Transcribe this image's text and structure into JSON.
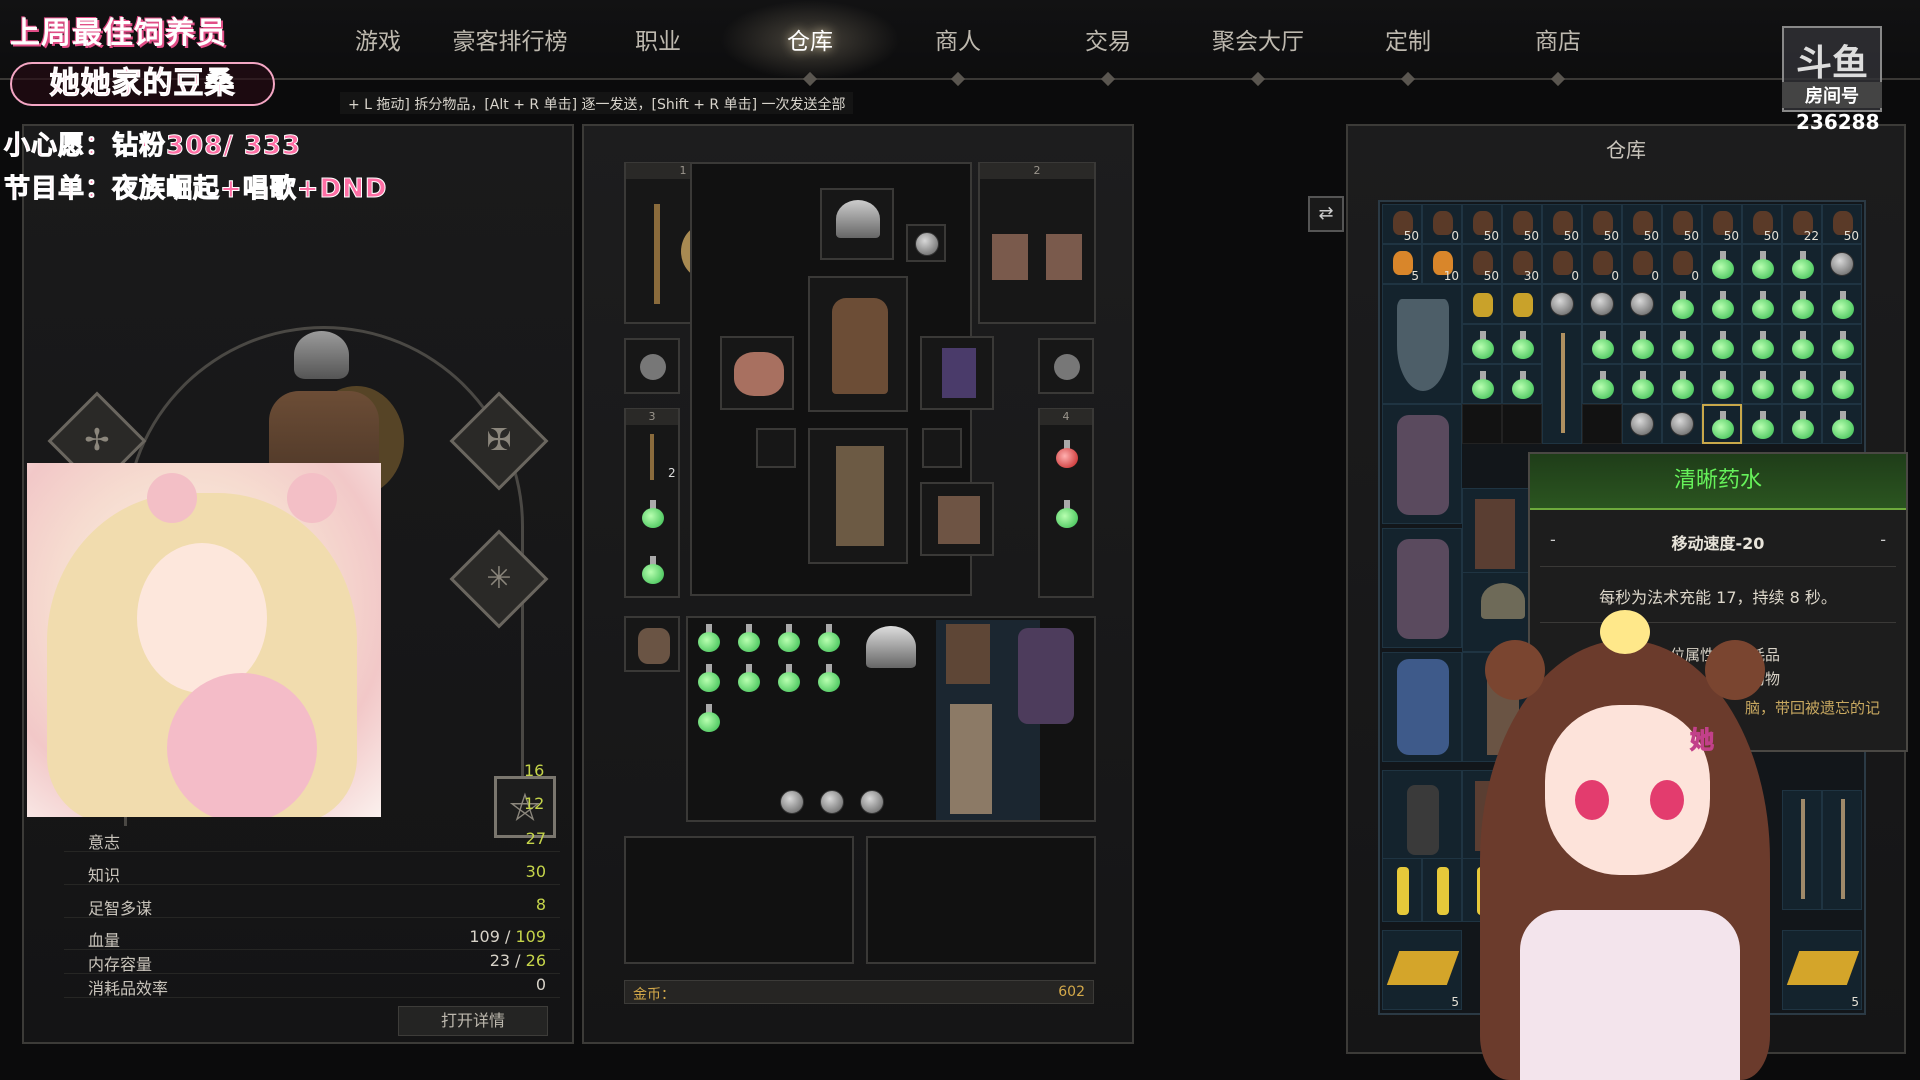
{
  "nav": {
    "items": [
      {
        "label": "游戏",
        "active": false
      },
      {
        "label": "豪客排行榜",
        "active": false
      },
      {
        "label": "职业",
        "active": false
      },
      {
        "label": "仓库",
        "active": true
      },
      {
        "label": "商人",
        "active": false
      },
      {
        "label": "交易",
        "active": false
      },
      {
        "label": "聚会大厅",
        "active": false
      },
      {
        "label": "定制",
        "active": false
      },
      {
        "label": "商店",
        "active": false
      }
    ]
  },
  "hint": "+ L 拖动] 拆分物品，[Alt + R 单击] 逐一发送，[Shift + R 单击] 一次发送全部",
  "overlay": {
    "line1": "上周最佳饲养员",
    "line2": "她她家的豆桑",
    "line3": "小心愿：钻粉308/ 333",
    "line4": "节目单：夜族崛起+唱歌+DND"
  },
  "stream": {
    "room_label": "房间号",
    "room_number": "236288"
  },
  "character": {
    "stat_top": [
      "16",
      "12"
    ],
    "stats": [
      {
        "label": "意志",
        "value": "27"
      },
      {
        "label": "知识",
        "value": "30"
      },
      {
        "label": "足智多谋",
        "value": "8"
      }
    ],
    "health": {
      "label": "血量",
      "current": "109",
      "max": "109"
    },
    "memory": {
      "label": "内存容量",
      "current": "23",
      "max": "26"
    },
    "consumable": {
      "label": "消耗品效率",
      "value": "0"
    },
    "detail_button": "打开详情"
  },
  "equipment": {
    "slot_labels": [
      "1",
      "2",
      "3",
      "4"
    ],
    "slot3_count": "2",
    "gold_label": "金币：",
    "gold_value": "602"
  },
  "storage": {
    "title": "仓库",
    "row1_counts": [
      "50",
      "0",
      "50",
      "50",
      "50",
      "50",
      "50",
      "50",
      "50",
      "50",
      "22",
      "50"
    ],
    "row2_counts": [
      "5",
      "10",
      "50",
      "30",
      "0",
      "0",
      "0",
      "0"
    ],
    "bottom_counts": [
      "5",
      "5"
    ]
  },
  "tooltip": {
    "title": "清晰药水",
    "dash_left": "-",
    "dash_right": "-",
    "stat": "移动速度-20",
    "description": "每秒为法术充能 17，持续 8 秒。",
    "attr1_label": "位属性:",
    "attr1_value": "消耗品",
    "attr2_value": "药物",
    "lore": "脑，带回被遗忘的记"
  },
  "colors": {
    "potion_green": "#2fb84a",
    "stat_green": "#c5d44a",
    "tooltip_title": "#66f25a",
    "overlay_pink": "#ff6fa5"
  }
}
